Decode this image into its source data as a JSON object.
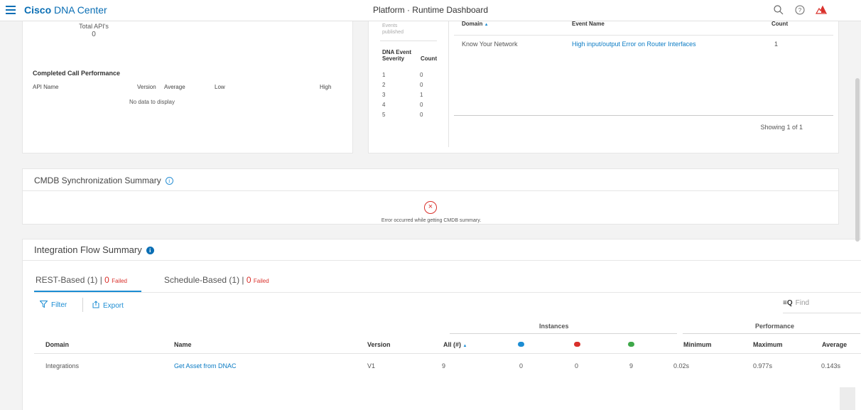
{
  "header": {
    "brand_bold": "Cisco",
    "brand_rest": "DNA Center",
    "title": "Platform · Runtime Dashboard",
    "icons": [
      "menu-icon",
      "search-icon",
      "help-icon",
      "alert-icon"
    ]
  },
  "api_card": {
    "total_label": "Total API's",
    "total_value": "0",
    "perf_title": "Completed Call Performance",
    "columns": [
      "API Name",
      "Version",
      "Average",
      "Low",
      "High"
    ],
    "empty_text": "No data to display"
  },
  "events_card": {
    "faded_top": "Events",
    "faded_bottom": "published",
    "severity_header_1": "DNA Event",
    "severity_header_2": "Severity",
    "count_header": "Count",
    "severity_rows": [
      {
        "severity": "1",
        "count": "0"
      },
      {
        "severity": "2",
        "count": "0"
      },
      {
        "severity": "3",
        "count": "1"
      },
      {
        "severity": "4",
        "count": "0"
      },
      {
        "severity": "5",
        "count": "0"
      }
    ],
    "table_headers": {
      "domain": "Domain",
      "event_name": "Event Name",
      "count": "Count"
    },
    "sort_glyph": "▲",
    "row": {
      "domain": "Know Your Network",
      "event_name": "High input/output Error on Router Interfaces",
      "count": "1"
    },
    "showing": "Showing 1 of 1"
  },
  "cmdb": {
    "title": "CMDB Synchronization Summary",
    "error_text": "Error occurred while getting CMDB summary."
  },
  "integration": {
    "title": "Integration Flow Summary",
    "tabs": [
      {
        "label": "REST-Based (1)",
        "failed_count": "0",
        "failed_label": "Failed"
      },
      {
        "label": "Schedule-Based (1)",
        "failed_count": "0",
        "failed_label": "Failed"
      }
    ],
    "toolbar": {
      "filter": "Filter",
      "export": "Export",
      "find_placeholder": "Find"
    },
    "group_headers": {
      "instances": "Instances",
      "performance": "Performance"
    },
    "columns": {
      "domain": "Domain",
      "name": "Name",
      "version": "Version",
      "all": "All (#)",
      "minimum": "Minimum",
      "maximum": "Maximum",
      "average": "Average"
    },
    "status_colors": {
      "in_progress": "#1c8dd3",
      "failed": "#d9302b",
      "success": "#3fa84a"
    },
    "rows": [
      {
        "domain": "Integrations",
        "name": "Get Asset from DNAC",
        "version": "V1",
        "all": "9",
        "in_progress": "0",
        "failed": "0",
        "success": "9",
        "minimum": "0.02s",
        "maximum": "0.977s",
        "average": "0.143s"
      }
    ]
  }
}
